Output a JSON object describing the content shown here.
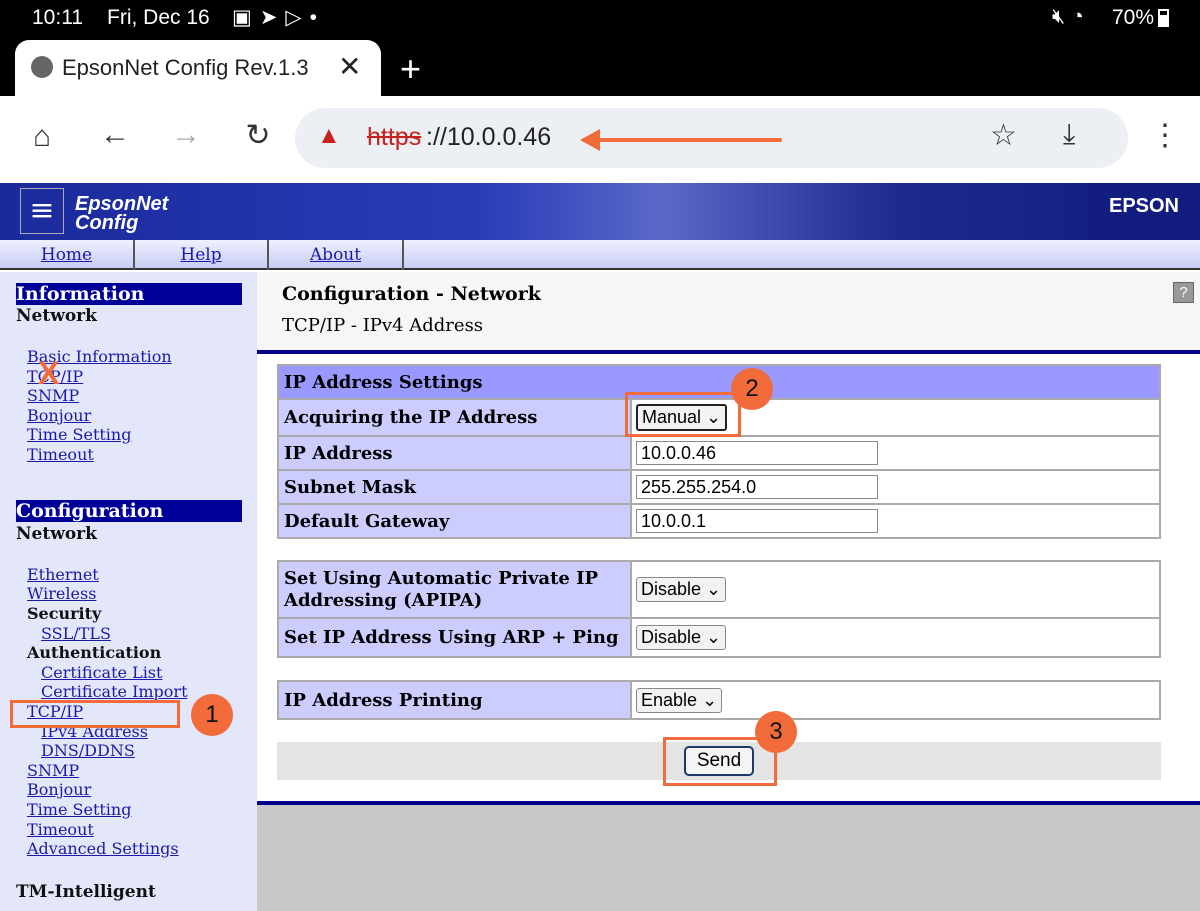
{
  "status_bar": {
    "time": "10:11",
    "date": "Fri, Dec 16",
    "battery": "70%",
    "icons": [
      "image-icon",
      "send-icon",
      "play-store-icon",
      "dot-icon",
      "mute-icon",
      "wifi-icon",
      "battery-icon"
    ]
  },
  "browser": {
    "tab_title": "EpsonNet Config Rev.1.3",
    "url_scheme": "https",
    "url_rest": "://10.0.0.46",
    "icons": [
      "globe-icon",
      "close-icon",
      "plus-icon",
      "home-icon",
      "back-icon",
      "forward-icon",
      "reload-icon",
      "warning-icon",
      "star-icon",
      "download-icon",
      "menu-icon"
    ]
  },
  "header": {
    "logo_line1": "EpsonNet",
    "logo_line2": "Config",
    "brand": "EPSON"
  },
  "nav": [
    "Home",
    "Help",
    "About"
  ],
  "sidebar": {
    "information": {
      "title": "Information",
      "subtitle": "Network",
      "links": [
        "Basic Information",
        "TCP/IP",
        "SNMP",
        "Bonjour",
        "Time Setting",
        "Timeout"
      ]
    },
    "configuration": {
      "title": "Configuration",
      "subtitle": "Network",
      "links1": [
        "Ethernet",
        "Wireless"
      ],
      "security": "Security",
      "ssl": "SSL/TLS",
      "authentication": "Authentication",
      "auth_links": [
        "Certificate List",
        "Certificate Import"
      ],
      "tcpip": "TCP/IP",
      "tcp_sub": [
        "IPv4 Address",
        "DNS/DDNS"
      ],
      "links2": [
        "SNMP",
        "Bonjour",
        "Time Setting",
        "Timeout",
        "Advanced Settings"
      ]
    },
    "tm": "TM-Intelligent"
  },
  "main": {
    "title": "Configuration - Network",
    "subtitle": "TCP/IP - IPv4 Address",
    "help": "?",
    "section": "IP Address Settings",
    "rows": [
      {
        "label": "Acquiring the IP Address",
        "value": "Manual"
      },
      {
        "label": "IP Address",
        "value": "10.0.0.46"
      },
      {
        "label": "Subnet Mask",
        "value": "255.255.254.0"
      },
      {
        "label": "Default Gateway",
        "value": "10.0.0.1"
      }
    ],
    "apipa": {
      "label": "Set Using Automatic Private IP Addressing (APIPA)",
      "value": "Disable"
    },
    "arp": {
      "label": "Set IP Address Using ARP + Ping",
      "value": "Disable"
    },
    "printing": {
      "label": "IP Address Printing",
      "value": "Enable"
    },
    "send": "Send"
  },
  "annotations": {
    "color": "#f26b3a",
    "steps": [
      "1",
      "2",
      "3"
    ],
    "x_mark": "X"
  }
}
